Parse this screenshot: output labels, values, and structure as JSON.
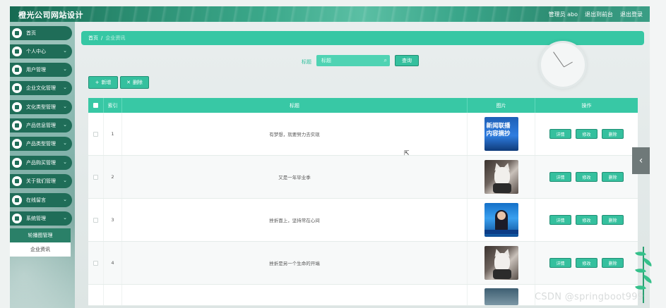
{
  "header": {
    "site_title": "橙光公司网站设计",
    "user_label": "管理员 abo",
    "goto_front": "退出到前台",
    "logout": "退出登录"
  },
  "sidebar": {
    "items": [
      {
        "label": "首页",
        "icon": "home-icon",
        "has_chevron": false
      },
      {
        "label": "个人中心",
        "icon": "user-icon",
        "has_chevron": true
      },
      {
        "label": "用户管理",
        "icon": "users-icon",
        "has_chevron": true
      },
      {
        "label": "企业文化管理",
        "icon": "culture-icon",
        "has_chevron": true
      },
      {
        "label": "文化类型管理",
        "icon": "book-icon",
        "has_chevron": true
      },
      {
        "label": "产品信息管理",
        "icon": "grid-icon",
        "has_chevron": true
      },
      {
        "label": "产品类型管理",
        "icon": "tag-icon",
        "has_chevron": true
      },
      {
        "label": "产品购买管理",
        "icon": "cart-icon",
        "has_chevron": true
      },
      {
        "label": "关于我们管理",
        "icon": "info-icon",
        "has_chevron": true
      },
      {
        "label": "在线留言",
        "icon": "message-icon",
        "has_chevron": true
      },
      {
        "label": "系统管理",
        "icon": "settings-icon",
        "has_chevron": true
      }
    ],
    "submenu": [
      {
        "label": "轮播图管理"
      },
      {
        "label": "企业资讯"
      }
    ]
  },
  "breadcrumb": {
    "home": "首页",
    "separator": "/",
    "current": "企业资讯"
  },
  "search": {
    "label": "标题",
    "placeholder": "标题",
    "query_button": "查询"
  },
  "actions": {
    "add": "新增",
    "delete": "删除"
  },
  "table": {
    "headers": {
      "index": "索引",
      "title": "标题",
      "image": "图片",
      "ops": "操作"
    },
    "rows": [
      {
        "index": "1",
        "title": "有梦想，就要努力去实现",
        "image": "news-thumbnail"
      },
      {
        "index": "2",
        "title": "又是一年毕业季",
        "image": "cat-thumbnail"
      },
      {
        "index": "3",
        "title": "挫折面上，坚持常在心间",
        "image": "tv-thumbnail"
      },
      {
        "index": "4",
        "title": "挫折是另一个生命的开端",
        "image": "cat-thumbnail"
      }
    ],
    "row_buttons": {
      "detail": "详情",
      "edit": "修改",
      "delete": "删除"
    },
    "news_thumb_text": [
      "新闻联播",
      "内容摘抄"
    ]
  },
  "watermark": "CSDN @springboot999",
  "colors": {
    "accent": "#36c7a4",
    "sidebar_item": "#1f6d58",
    "button_border": "#1f8f74"
  }
}
